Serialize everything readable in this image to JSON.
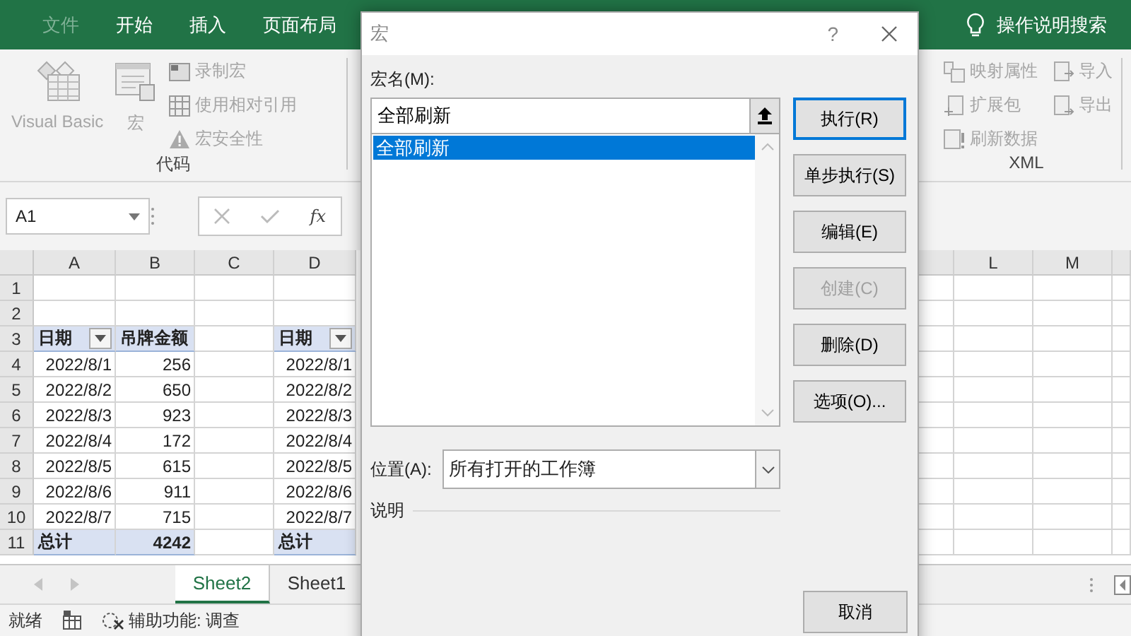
{
  "ribbon_tabs": [
    {
      "label": "文件",
      "kind": "file"
    },
    {
      "label": "开始",
      "kind": "tab"
    },
    {
      "label": "插入",
      "kind": "tab"
    },
    {
      "label": "页面布局",
      "kind": "tab"
    }
  ],
  "tell_me": "操作说明搜索",
  "code_group": {
    "large_buttons": [
      {
        "label": "Visual Basic",
        "kind": "vb",
        "disabled": true
      },
      {
        "label": "宏",
        "kind": "macro",
        "disabled": true
      }
    ],
    "small_buttons": [
      {
        "label": "录制宏",
        "kind": "record",
        "disabled": true
      },
      {
        "label": "使用相对引用",
        "kind": "relative",
        "disabled": true
      },
      {
        "label": "宏安全性",
        "kind": "security",
        "disabled": true
      }
    ],
    "label": "代码"
  },
  "xml_group": {
    "items": [
      {
        "label": "映射属性",
        "kind": "map",
        "disabled": true
      },
      {
        "label": "导入",
        "kind": "import",
        "disabled": true
      },
      {
        "label": "扩展包",
        "kind": "pack",
        "disabled": true
      },
      {
        "label": "导出",
        "kind": "export",
        "disabled": true
      },
      {
        "label": "刷新数据",
        "kind": "refresh",
        "disabled": true
      }
    ],
    "label": "XML"
  },
  "formula_bar": {
    "name_box": "A1",
    "function_label": "fx"
  },
  "sheet": {
    "left_columns": [
      "A",
      "B",
      "C",
      "D"
    ],
    "right_columns": [
      "L",
      "M"
    ],
    "rows": [
      {
        "number": "1",
        "kind": "blank"
      },
      {
        "number": "2",
        "kind": "blank"
      },
      {
        "number": "3",
        "kind": "header",
        "a": "日期",
        "b": "吊牌金额",
        "d": "日期"
      },
      {
        "number": "4",
        "kind": "data",
        "a": "2022/8/1",
        "b": "256",
        "d": "2022/8/1"
      },
      {
        "number": "5",
        "kind": "data",
        "a": "2022/8/2",
        "b": "650",
        "d": "2022/8/2"
      },
      {
        "number": "6",
        "kind": "data",
        "a": "2022/8/3",
        "b": "923",
        "d": "2022/8/3"
      },
      {
        "number": "7",
        "kind": "data",
        "a": "2022/8/4",
        "b": "172",
        "d": "2022/8/4"
      },
      {
        "number": "8",
        "kind": "data",
        "a": "2022/8/5",
        "b": "615",
        "d": "2022/8/5"
      },
      {
        "number": "9",
        "kind": "data",
        "a": "2022/8/6",
        "b": "911",
        "d": "2022/8/6"
      },
      {
        "number": "10",
        "kind": "data",
        "a": "2022/8/7",
        "b": "715",
        "d": "2022/8/7"
      },
      {
        "number": "11",
        "kind": "total",
        "a": "总计",
        "b": "4242",
        "d": "总计"
      }
    ]
  },
  "sheet_tabs": [
    {
      "label": "Sheet2",
      "selected": true
    },
    {
      "label": "Sheet1",
      "selected": false
    }
  ],
  "status_bar": {
    "ready": "就绪",
    "accessibility": "辅助功能: 调查"
  },
  "dialog": {
    "title": "宏",
    "help": "?",
    "name_label": "宏名(M):",
    "name_value": "全部刷新",
    "macros": [
      {
        "label": "全部刷新",
        "selected": true
      }
    ],
    "location_label": "位置(A):",
    "location_value": "所有打开的工作簿",
    "description_label": "说明",
    "buttons": [
      {
        "label": "执行(R)",
        "default": true,
        "disabled": false
      },
      {
        "label": "单步执行(S)",
        "default": false,
        "disabled": false
      },
      {
        "label": "编辑(E)",
        "default": false,
        "disabled": false
      },
      {
        "label": "创建(C)",
        "default": false,
        "disabled": true
      },
      {
        "label": "删除(D)",
        "default": false,
        "disabled": false
      },
      {
        "label": "选项(O)...",
        "default": false,
        "disabled": false
      }
    ],
    "cancel_button": "取消"
  }
}
